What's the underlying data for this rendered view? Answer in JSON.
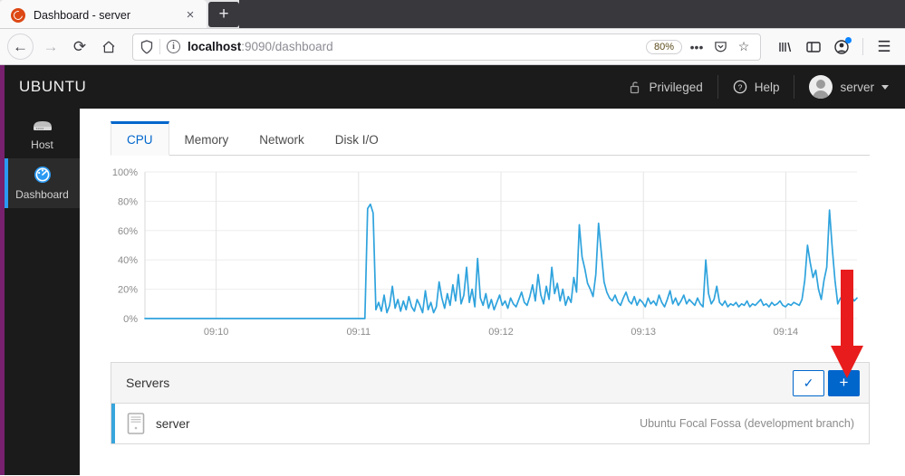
{
  "browser": {
    "tab": {
      "title": "Dashboard - server",
      "favicon": "ubuntu-icon",
      "close_label": "×"
    },
    "new_tab_label": "+",
    "nav": {
      "back_label": "←",
      "forward_label": "→",
      "reload_label": "⟳",
      "home_label": "⌂"
    },
    "url": {
      "host": "localhost",
      "path": ":9090/dashboard",
      "full": "localhost:9090/dashboard"
    },
    "zoom_level": "80%",
    "url_actions": {
      "more_label": "•••",
      "pocket_label": "pocket-icon",
      "bookmark_label": "☆"
    },
    "toolbar": {
      "library_label": "library-icon",
      "sidebar_label": "sidebar-icon",
      "account_label": "account-icon",
      "menu_label": "☰"
    }
  },
  "cockpit": {
    "brand": "UBUNTU",
    "header": {
      "privileged_label": "Privileged",
      "help_label": "Help",
      "user_label": "server"
    },
    "sidebar": {
      "items": [
        {
          "label": "Host",
          "icon": "server-icon",
          "active": false
        },
        {
          "label": "Dashboard",
          "icon": "gauge-icon",
          "active": true
        }
      ]
    },
    "tabs": [
      {
        "label": "CPU",
        "active": true
      },
      {
        "label": "Memory",
        "active": false
      },
      {
        "label": "Network",
        "active": false
      },
      {
        "label": "Disk I/O",
        "active": false
      }
    ],
    "panel": {
      "title": "Servers",
      "check_button_label": "✓",
      "add_button_label": "+",
      "rows": [
        {
          "name": "server",
          "os": "Ubuntu Focal Fossa (development branch)",
          "icon": "server-tower-icon"
        }
      ]
    },
    "annotation": {
      "arrow": "red-down-arrow",
      "color": "#e81c1c"
    }
  },
  "chart_data": {
    "type": "line",
    "title": "",
    "xlabel": "",
    "ylabel": "",
    "ylim": [
      0,
      100
    ],
    "ytick_labels": [
      "0%",
      "20%",
      "40%",
      "60%",
      "80%",
      "100%"
    ],
    "ytick_values": [
      0,
      20,
      40,
      60,
      80,
      100
    ],
    "xtick_labels": [
      "09:10",
      "09:11",
      "09:12",
      "09:13",
      "09:14"
    ],
    "xtick_positions": [
      0.1,
      0.3,
      0.5,
      0.7,
      0.9
    ],
    "grid": true,
    "line_color": "#2fa3dd",
    "series": [
      {
        "name": "CPU",
        "values": [
          0,
          0,
          0,
          0,
          0,
          0,
          0,
          0,
          0,
          0,
          0,
          0,
          0,
          0,
          0,
          0,
          0,
          0,
          0,
          0,
          0,
          0,
          0,
          0,
          0,
          0,
          0,
          0,
          0,
          0,
          0,
          0,
          0,
          0,
          0,
          0,
          0,
          0,
          0,
          0,
          0,
          0,
          0,
          0,
          0,
          0,
          0,
          0,
          0,
          0,
          0,
          0,
          0,
          0,
          0,
          0,
          0,
          0,
          0,
          0,
          0,
          0,
          0,
          0,
          0,
          0,
          0,
          0,
          0,
          0,
          0,
          0,
          0,
          0,
          0,
          0,
          0,
          0,
          0,
          0,
          0,
          75,
          78,
          72,
          6,
          11,
          5,
          16,
          4,
          9,
          22,
          7,
          13,
          5,
          12,
          6,
          15,
          8,
          5,
          13,
          9,
          4,
          19,
          6,
          11,
          4,
          8,
          25,
          14,
          7,
          17,
          9,
          23,
          12,
          30,
          10,
          16,
          35,
          11,
          20,
          8,
          41,
          14,
          9,
          17,
          7,
          13,
          6,
          11,
          16,
          9,
          12,
          7,
          14,
          10,
          8,
          13,
          18,
          11,
          9,
          15,
          23,
          12,
          30,
          16,
          10,
          22,
          13,
          35,
          17,
          24,
          12,
          20,
          9,
          15,
          11,
          28,
          18,
          64,
          42,
          34,
          24,
          20,
          15,
          30,
          65,
          45,
          25,
          18,
          14,
          12,
          16,
          11,
          9,
          14,
          18,
          12,
          10,
          15,
          9,
          13,
          11,
          8,
          14,
          10,
          12,
          9,
          16,
          11,
          8,
          13,
          19,
          10,
          14,
          9,
          12,
          16,
          10,
          13,
          11,
          9,
          14,
          10,
          8,
          40,
          17,
          10,
          13,
          22,
          11,
          9,
          12,
          8,
          10,
          9,
          11,
          8,
          10,
          9,
          12,
          8,
          10,
          9,
          11,
          13,
          9,
          10,
          8,
          11,
          9,
          10,
          12,
          9,
          8,
          10,
          9,
          11,
          10,
          9,
          13,
          26,
          50,
          38,
          28,
          33,
          20,
          13,
          26,
          35,
          74,
          48,
          26,
          10,
          14,
          12,
          16,
          13,
          15,
          12,
          14
        ]
      }
    ]
  }
}
